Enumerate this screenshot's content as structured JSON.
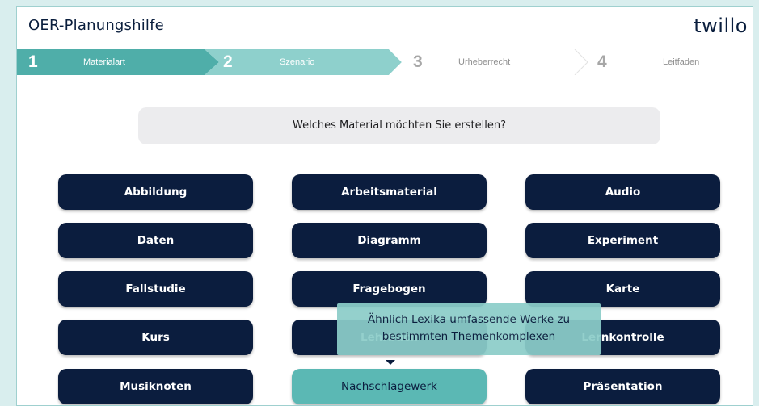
{
  "header": {
    "title": "OER-Planungshilfe",
    "brand": "twillo"
  },
  "stepper": {
    "steps": [
      {
        "number": "1",
        "label": "Materialart",
        "state": "active"
      },
      {
        "number": "2",
        "label": "Szenario",
        "state": "active"
      },
      {
        "number": "3",
        "label": "Urheberrecht",
        "state": "inactive"
      },
      {
        "number": "4",
        "label": "Leitfaden",
        "state": "inactive"
      }
    ]
  },
  "question": "Welches Material möchten Sie erstellen?",
  "materials": [
    "Abbildung",
    "Arbeitsmaterial",
    "Audio",
    "Daten",
    "Diagramm",
    "Experiment",
    "Fallstudie",
    "Fragebogen",
    "Karte",
    "Kurs",
    "Lehrbuch",
    "Lernkontrolle",
    "Musiknoten",
    "Nachschlagewerk",
    "Präsentation"
  ],
  "selected_material": "Nachschlagewerk",
  "tooltip": {
    "line1": "Ähnlich Lexika umfassende Werke zu",
    "line2": "bestimmten Themenkomplexen"
  },
  "colors": {
    "accent": "#5bb8b4",
    "accent_dark": "#2f9a95",
    "button": "#0b1d3e",
    "text_dark": "#0a1e3d"
  }
}
